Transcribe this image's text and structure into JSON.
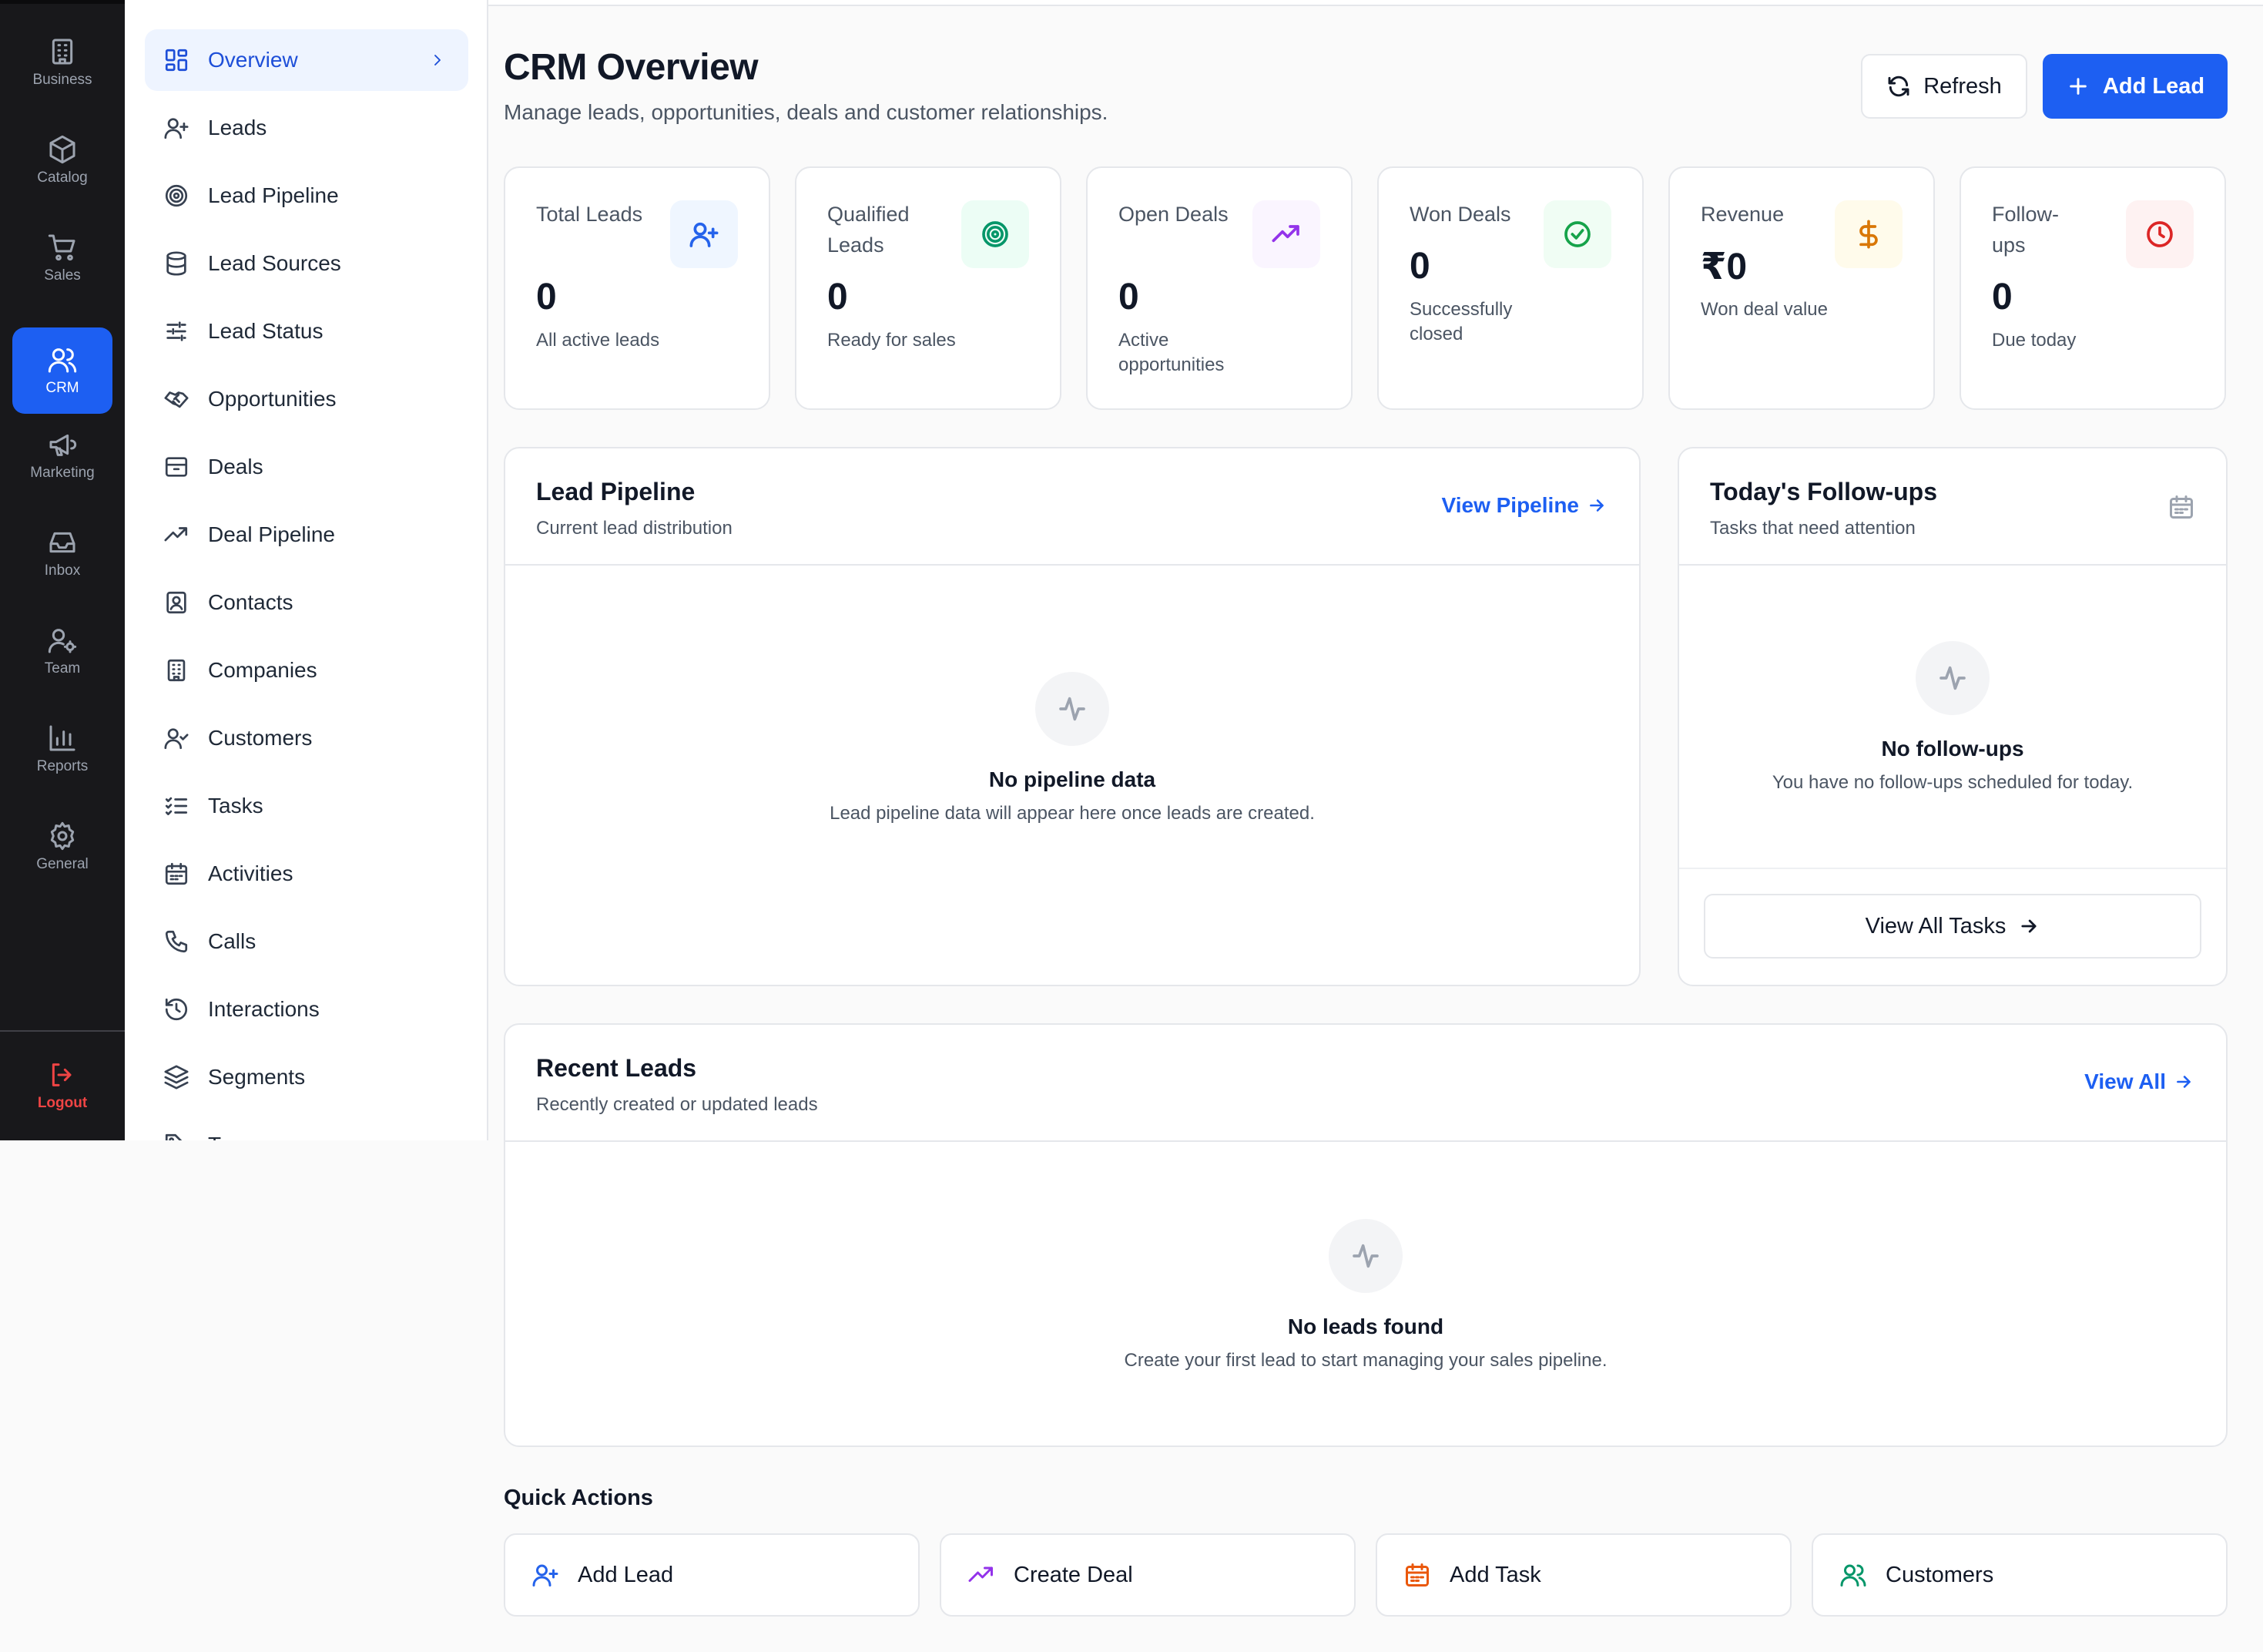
{
  "rail": {
    "items": [
      {
        "label": "Business",
        "icon": "building-icon"
      },
      {
        "label": "Catalog",
        "icon": "box-icon"
      },
      {
        "label": "Sales",
        "icon": "cart-icon"
      },
      {
        "label": "CRM",
        "icon": "users-icon",
        "active": true
      },
      {
        "label": "Marketing",
        "icon": "megaphone-icon"
      },
      {
        "label": "Inbox",
        "icon": "inbox-icon"
      },
      {
        "label": "Team",
        "icon": "user-gear-icon"
      },
      {
        "label": "Reports",
        "icon": "bar-chart-icon"
      },
      {
        "label": "General",
        "icon": "gear-icon"
      }
    ],
    "logout": "Logout"
  },
  "subnav": {
    "items": [
      {
        "label": "Overview",
        "icon": "dashboard-icon",
        "active": true
      },
      {
        "label": "Leads",
        "icon": "user-plus-icon"
      },
      {
        "label": "Lead Pipeline",
        "icon": "target-icon"
      },
      {
        "label": "Lead Sources",
        "icon": "database-icon"
      },
      {
        "label": "Lead Status",
        "icon": "sliders-icon"
      },
      {
        "label": "Opportunities",
        "icon": "handshake-icon"
      },
      {
        "label": "Deals",
        "icon": "archive-icon"
      },
      {
        "label": "Deal Pipeline",
        "icon": "trending-up-icon"
      },
      {
        "label": "Contacts",
        "icon": "contact-icon"
      },
      {
        "label": "Companies",
        "icon": "building-icon"
      },
      {
        "label": "Customers",
        "icon": "user-check-icon"
      },
      {
        "label": "Tasks",
        "icon": "list-checks-icon"
      },
      {
        "label": "Activities",
        "icon": "calendar-icon"
      },
      {
        "label": "Calls",
        "icon": "phone-icon"
      },
      {
        "label": "Interactions",
        "icon": "history-icon"
      },
      {
        "label": "Segments",
        "icon": "layers-icon"
      },
      {
        "label": "Tags",
        "icon": "tag-icon"
      }
    ]
  },
  "header": {
    "title": "CRM Overview",
    "subtitle": "Manage leads, opportunities, deals and customer relationships.",
    "refresh_label": "Refresh",
    "add_lead_label": "Add Lead"
  },
  "stats": [
    {
      "label": "Total Leads",
      "value": "0",
      "note": "All active leads",
      "icon": "user-plus-icon",
      "color": "#2563eb",
      "bg": "#eff6ff"
    },
    {
      "label": "Qualified Leads",
      "value": "0",
      "note": "Ready for sales",
      "icon": "target-icon",
      "color": "#059669",
      "bg": "#ecfdf5"
    },
    {
      "label": "Open Deals",
      "value": "0",
      "note": "Active opportunities",
      "icon": "trending-up-icon",
      "color": "#9333ea",
      "bg": "#faf5ff"
    },
    {
      "label": "Won Deals",
      "value": "0",
      "note": "Successfully closed",
      "icon": "check-circle-icon",
      "color": "#16a34a",
      "bg": "#f0fdf4"
    },
    {
      "label": "Revenue",
      "value": "₹0",
      "note": "Won deal value",
      "icon": "dollar-icon",
      "color": "#d97706",
      "bg": "#fffbeb"
    },
    {
      "label": "Follow-ups",
      "value": "0",
      "note": "Due today",
      "icon": "clock-icon",
      "color": "#dc2626",
      "bg": "#fef2f2"
    }
  ],
  "pipeline": {
    "title": "Lead Pipeline",
    "subtitle": "Current lead distribution",
    "link": "View Pipeline",
    "empty_title": "No pipeline data",
    "empty_text": "Lead pipeline data will appear here once leads are created."
  },
  "followups": {
    "title": "Today's Follow-ups",
    "subtitle": "Tasks that need attention",
    "empty_title": "No follow-ups",
    "empty_text": "You have no follow-ups scheduled for today.",
    "button": "View All Tasks"
  },
  "recent": {
    "title": "Recent Leads",
    "subtitle": "Recently created or updated leads",
    "link": "View All",
    "empty_title": "No leads found",
    "empty_text": "Create your first lead to start managing your sales pipeline."
  },
  "quick_actions": {
    "title": "Quick Actions",
    "items": [
      {
        "label": "Add Lead",
        "icon": "user-plus-icon",
        "color": "#2563eb"
      },
      {
        "label": "Create Deal",
        "icon": "trending-up-icon",
        "color": "#9333ea"
      },
      {
        "label": "Add Task",
        "icon": "calendar-icon",
        "color": "#ea580c"
      },
      {
        "label": "Customers",
        "icon": "users-icon",
        "color": "#059669"
      }
    ]
  },
  "colors": {
    "accent": "#1d5ff2",
    "rail_bg": "#18181b",
    "logout": "#ef4444"
  }
}
